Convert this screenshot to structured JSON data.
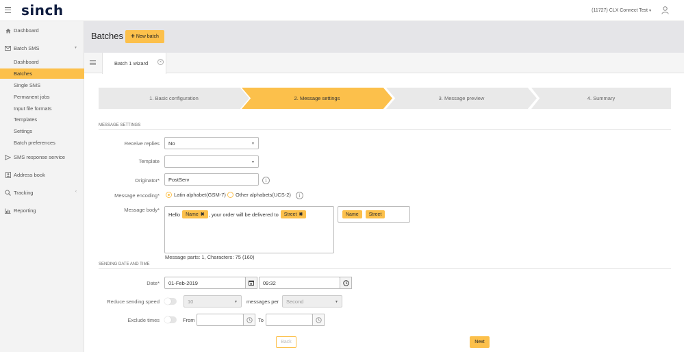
{
  "brand": {
    "logo": "sinch",
    "accent": "#fcc04b"
  },
  "account": {
    "name": "(11727) CLX Connect Test"
  },
  "sidebar": {
    "items": [
      {
        "label": "Dashboard",
        "icon": "home-icon"
      },
      {
        "label": "Batch SMS",
        "icon": "envelope-icon"
      },
      {
        "label": "Dashboard"
      },
      {
        "label": "Batches",
        "active": true
      },
      {
        "label": "Single SMS"
      },
      {
        "label": "Permanent jobs"
      },
      {
        "label": "Input file formats"
      },
      {
        "label": "Templates"
      },
      {
        "label": "Settings"
      },
      {
        "label": "Batch preferences"
      },
      {
        "label": "SMS response service",
        "icon": "send-icon"
      },
      {
        "label": "Address book",
        "icon": "contact-icon"
      },
      {
        "label": "Tracking",
        "icon": "search-icon"
      },
      {
        "label": "Reporting",
        "icon": "bar-chart-icon"
      }
    ]
  },
  "header": {
    "title": "Batches",
    "new_batch_label": "New batch"
  },
  "tabs": [
    {
      "label": "Batch 1 wizard"
    }
  ],
  "wizard": {
    "steps": [
      "1. Basic configuration",
      "2. Message settings",
      "3. Message preview",
      "4. Summary"
    ],
    "active_step": 2
  },
  "message_settings": {
    "section_title": "MESSAGE SETTINGS",
    "receive_replies": {
      "label": "Receive replies",
      "value": "No"
    },
    "template": {
      "label": "Template",
      "value": ""
    },
    "originator": {
      "label": "Originator*",
      "value": "PostServ"
    },
    "encoding": {
      "label": "Message encoding*",
      "option1": "Latin alphabet(GSM-7)",
      "option2": "Other alphabets(UCS-2)",
      "selected": 1
    },
    "message_body": {
      "label": "Message body*",
      "text_before": "Hello",
      "var1": "Name",
      "text_middle": ", your order will be delivered to",
      "var2": "Street"
    },
    "variables": [
      "Name",
      "Street"
    ],
    "message_parts": "Message parts: 1, Characters: 75 (160)"
  },
  "sending": {
    "section_title": "SENDING DATE AND TIME",
    "date": {
      "label": "Date*",
      "value": "01-Feb-2019",
      "time": "09:32"
    },
    "reduce_speed": {
      "label": "Reduce sending speed",
      "count": "10",
      "per_label": "messages per",
      "unit": "Second"
    },
    "exclude_times": {
      "label": "Exclude times",
      "from_label": "From",
      "to_label": "To"
    }
  },
  "actions": {
    "back": "Back",
    "next": "Next"
  }
}
